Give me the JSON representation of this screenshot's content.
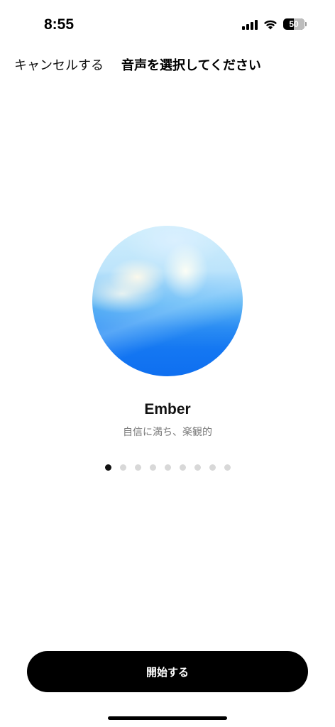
{
  "status_bar": {
    "time": "8:55",
    "battery_percent": "50",
    "battery_level": 0.5,
    "icons": [
      "cellular-signal-icon",
      "wifi-icon",
      "battery-icon"
    ]
  },
  "nav": {
    "cancel_label": "キャンセルする",
    "title": "音声を選択してください"
  },
  "voice": {
    "name": "Ember",
    "description": "自信に満ち、楽観的",
    "orb_colors": [
      "#cfeefc",
      "#5fb6f5",
      "#1477f2"
    ]
  },
  "pager": {
    "count": 9,
    "active_index": 0
  },
  "actions": {
    "start_label": "開始する"
  }
}
